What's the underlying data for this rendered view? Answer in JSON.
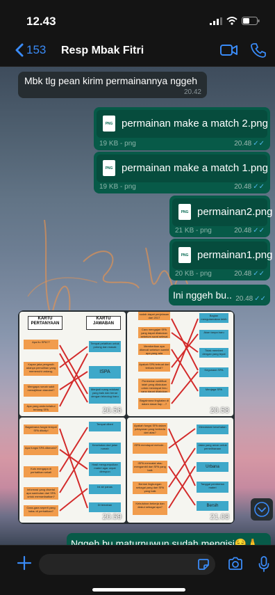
{
  "status_bar": {
    "time": "12.43"
  },
  "nav": {
    "back_count": "153",
    "contact_name": "Resp Mbak Fitri"
  },
  "messages": [
    {
      "type": "text",
      "direction": "in",
      "text": "Mbk tlg pean kirim permainannya nggeh",
      "time": "20.42"
    },
    {
      "type": "file",
      "direction": "out",
      "icon_label": "PNG",
      "name": "permainan make a match 2.png",
      "size": "19 KB",
      "ext": "png",
      "time": "20.48"
    },
    {
      "type": "file",
      "direction": "out",
      "icon_label": "PNG",
      "name": "permainan make a match 1.png",
      "size": "19 KB",
      "ext": "png",
      "time": "20.48"
    },
    {
      "type": "file",
      "direction": "out",
      "icon_label": "PNG",
      "name": "permainan2.png",
      "size": "21 KB",
      "ext": "png",
      "time": "20.48"
    },
    {
      "type": "file",
      "direction": "out",
      "icon_label": "PNG",
      "name": "permainan1.png",
      "size": "20 KB",
      "ext": "png",
      "time": "20.48"
    },
    {
      "type": "text",
      "direction": "out",
      "text": "Ini nggeh bu..",
      "time": "20.48"
    },
    {
      "type": "text",
      "direction": "out",
      "text": "Nggeh bu maturnuwun sudah mengisi😌🙏"
    }
  ],
  "album": {
    "photos": [
      {
        "time": "20.56",
        "headers": [
          "KARTU PERTANYAAN",
          "KARTU JAWABAN"
        ],
        "left_cards": [
          "Apa itu SPA??",
          "Kapan jaka pengasih adanya pemulihan yang memenuhi undang-",
          "Mengapa rumah sakit mewajibkan standart?",
          "Apa yang anda ketahui tentang SPA"
        ],
        "right_cards": [
          "Tempat pelatihan untuk potong dan masak",
          "ISPA",
          "Menjadi ruang edukasi yang baik dan benar dengan teknologi baru"
        ]
      },
      {
        "time": "20.58",
        "left_cards": [
          "sudah dapat penjelasan dari 2017",
          "Cara mengajari SPA yang dapat dilakukan sebelum surat selesai",
          "Memberikan apa dikenali sebelum sambil apa yang ada",
          "Apakah SPA terbuat dari terbaru berdi?",
          "Pemberian sertifikat ialah yang dilakukan untuk mendapat ilmu yang dapat dilakukan",
          "Bagaimana tingkatan di dalam dasar tiap ...?"
        ],
        "right_cards": [
          "Bagian mengutamakan lebih",
          "Akan tanpa baru",
          "Tidak memberi dengan yang tepat",
          "Kegunaan SPA",
          "Menjaga SPA"
        ]
      },
      {
        "time": "20.59",
        "left_cards": [
          "Bagaimana fungsi tempat SPA dikutip!",
          "Apa fungsi SPA dibenahi?",
          "Kuis mengapa di perhatikan sekali",
          "Informasi yang disertai apa sambutan dari SPA untuk memanfaatkan?",
          "Gara-gara seperti yang kalau di perhatikan?"
        ],
        "right_cards": [
          "Tempat diberi",
          "Kesehatan dari jalan rumah",
          "Hasil mengumpulkan materi agar cepat direspon",
          "Ini air panas",
          "Di temahan"
        ]
      },
      {
        "time": "21.08",
        "left_cards": [
          "Apakah fungsi SPA dalam pelayanan yang berbeda dari atas?",
          "ISPA mendapat metode...",
          "ISPA mencatat atau mengambil dari SPA yang baik",
          "Bentuk lingkungan sebagai yang dari SPA yang baik",
          "Kebutuhan bekerja dan diakui sebagai apa?"
        ],
        "right_cards": [
          "Mendalami kesehatan",
          "Jalan yang aman untuk pemeliharaan",
          "Urbana",
          "Tanggal pemberian materi",
          "Bersih"
        ]
      }
    ]
  },
  "input": {
    "placeholder": ""
  }
}
